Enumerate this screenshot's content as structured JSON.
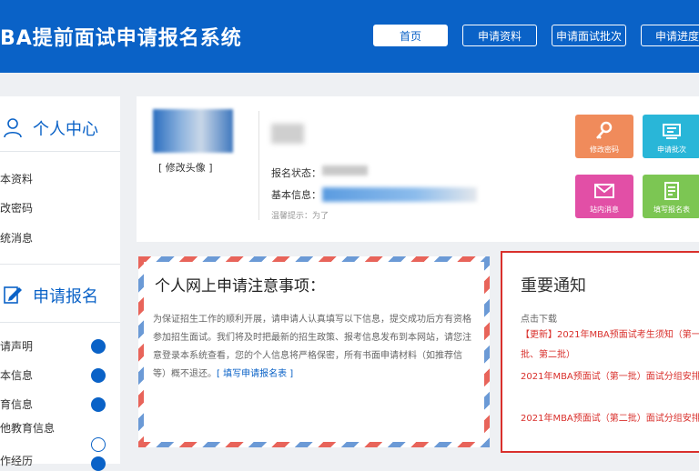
{
  "header": {
    "title": "BA提前面试申请报名系统",
    "nav": [
      "首页",
      "申请资料",
      "申请面试批次",
      "申请进度"
    ]
  },
  "sidebar": {
    "personal_center": {
      "label": "个人中心",
      "links": [
        "本资料",
        "改密码",
        "统消息"
      ]
    },
    "application": {
      "label": "申请报名",
      "items": [
        {
          "label": "请声明",
          "done": true
        },
        {
          "label": "本信息",
          "done": true
        },
        {
          "label": "育信息",
          "done": true
        },
        {
          "label": "他教育信息",
          "done": false
        },
        {
          "label": "作经历",
          "done": true
        }
      ]
    }
  },
  "profile": {
    "change_avatar": "[ 修改头像 ]",
    "status_label": "报名状态：",
    "basic_info_label": "基本信息：",
    "tip": "温馨提示：为了",
    "tiles": [
      {
        "label": "修改密码",
        "icon": "key-icon",
        "color": "#f08b5b"
      },
      {
        "label": "申请批次",
        "icon": "stack-icon",
        "color": "#29b6d8"
      },
      {
        "label": "站内消息",
        "icon": "mail-icon",
        "color": "#e24fa6"
      },
      {
        "label": "填写报名表",
        "icon": "form-icon",
        "color": "#7cc653"
      }
    ]
  },
  "notice": {
    "title": "个人网上申请注意事项：",
    "body": "为保证招生工作的顺利开展，请申请人认真填写以下信息，提交成功后方有资格参加招生面试。我们将及时把最新的招生政策、报考信息发布到本网站，请您注意登录本系统查看，您的个人信息将严格保密，所有书面申请材料（如推荐信等）概不退还。",
    "link": "[ 填写申请报名表 ]"
  },
  "announcement": {
    "title": "重要通知",
    "sub": "点击下载",
    "items": [
      "【更新】2021年MBA预面试考生须知（第一批、第二批）",
      "2021年MBA预面试（第一批）面试分组安排",
      "2021年MBA预面试（第二批）面试分组安排"
    ]
  },
  "colors": {
    "primary": "#0a62c7",
    "alert": "#d9302c"
  }
}
